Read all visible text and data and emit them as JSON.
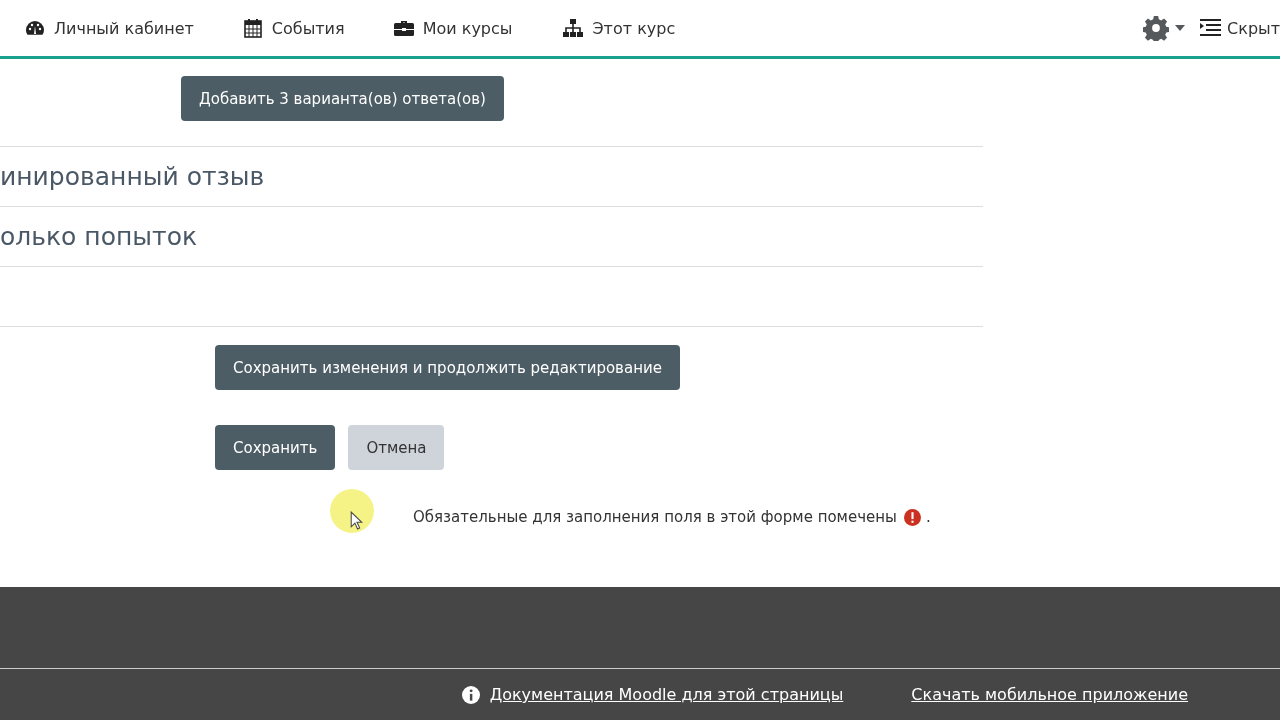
{
  "navbar": {
    "items": [
      {
        "label": "Личный кабинет"
      },
      {
        "label": "События"
      },
      {
        "label": "Мои курсы"
      },
      {
        "label": "Этот курс"
      }
    ],
    "hide_label": "Скрыт"
  },
  "add_button": "Добавить 3 варианта(ов) ответа(ов)",
  "sections": [
    {
      "title": "инированный отзыв"
    },
    {
      "title": "олько попыток"
    }
  ],
  "save_continue_button": "Сохранить изменения и продолжить редактирование",
  "buttons": [
    {
      "label": "Сохранить",
      "kind": "primary"
    },
    {
      "label": "Отмена",
      "kind": "secondary"
    }
  ],
  "required_note": "Обязательные для заполнения поля в этой форме помечены",
  "required_note_end": ".",
  "footer": {
    "links": [
      {
        "label": "Документация Moodle для этой страницы"
      },
      {
        "label": "Скачать мобильное приложение"
      }
    ]
  }
}
